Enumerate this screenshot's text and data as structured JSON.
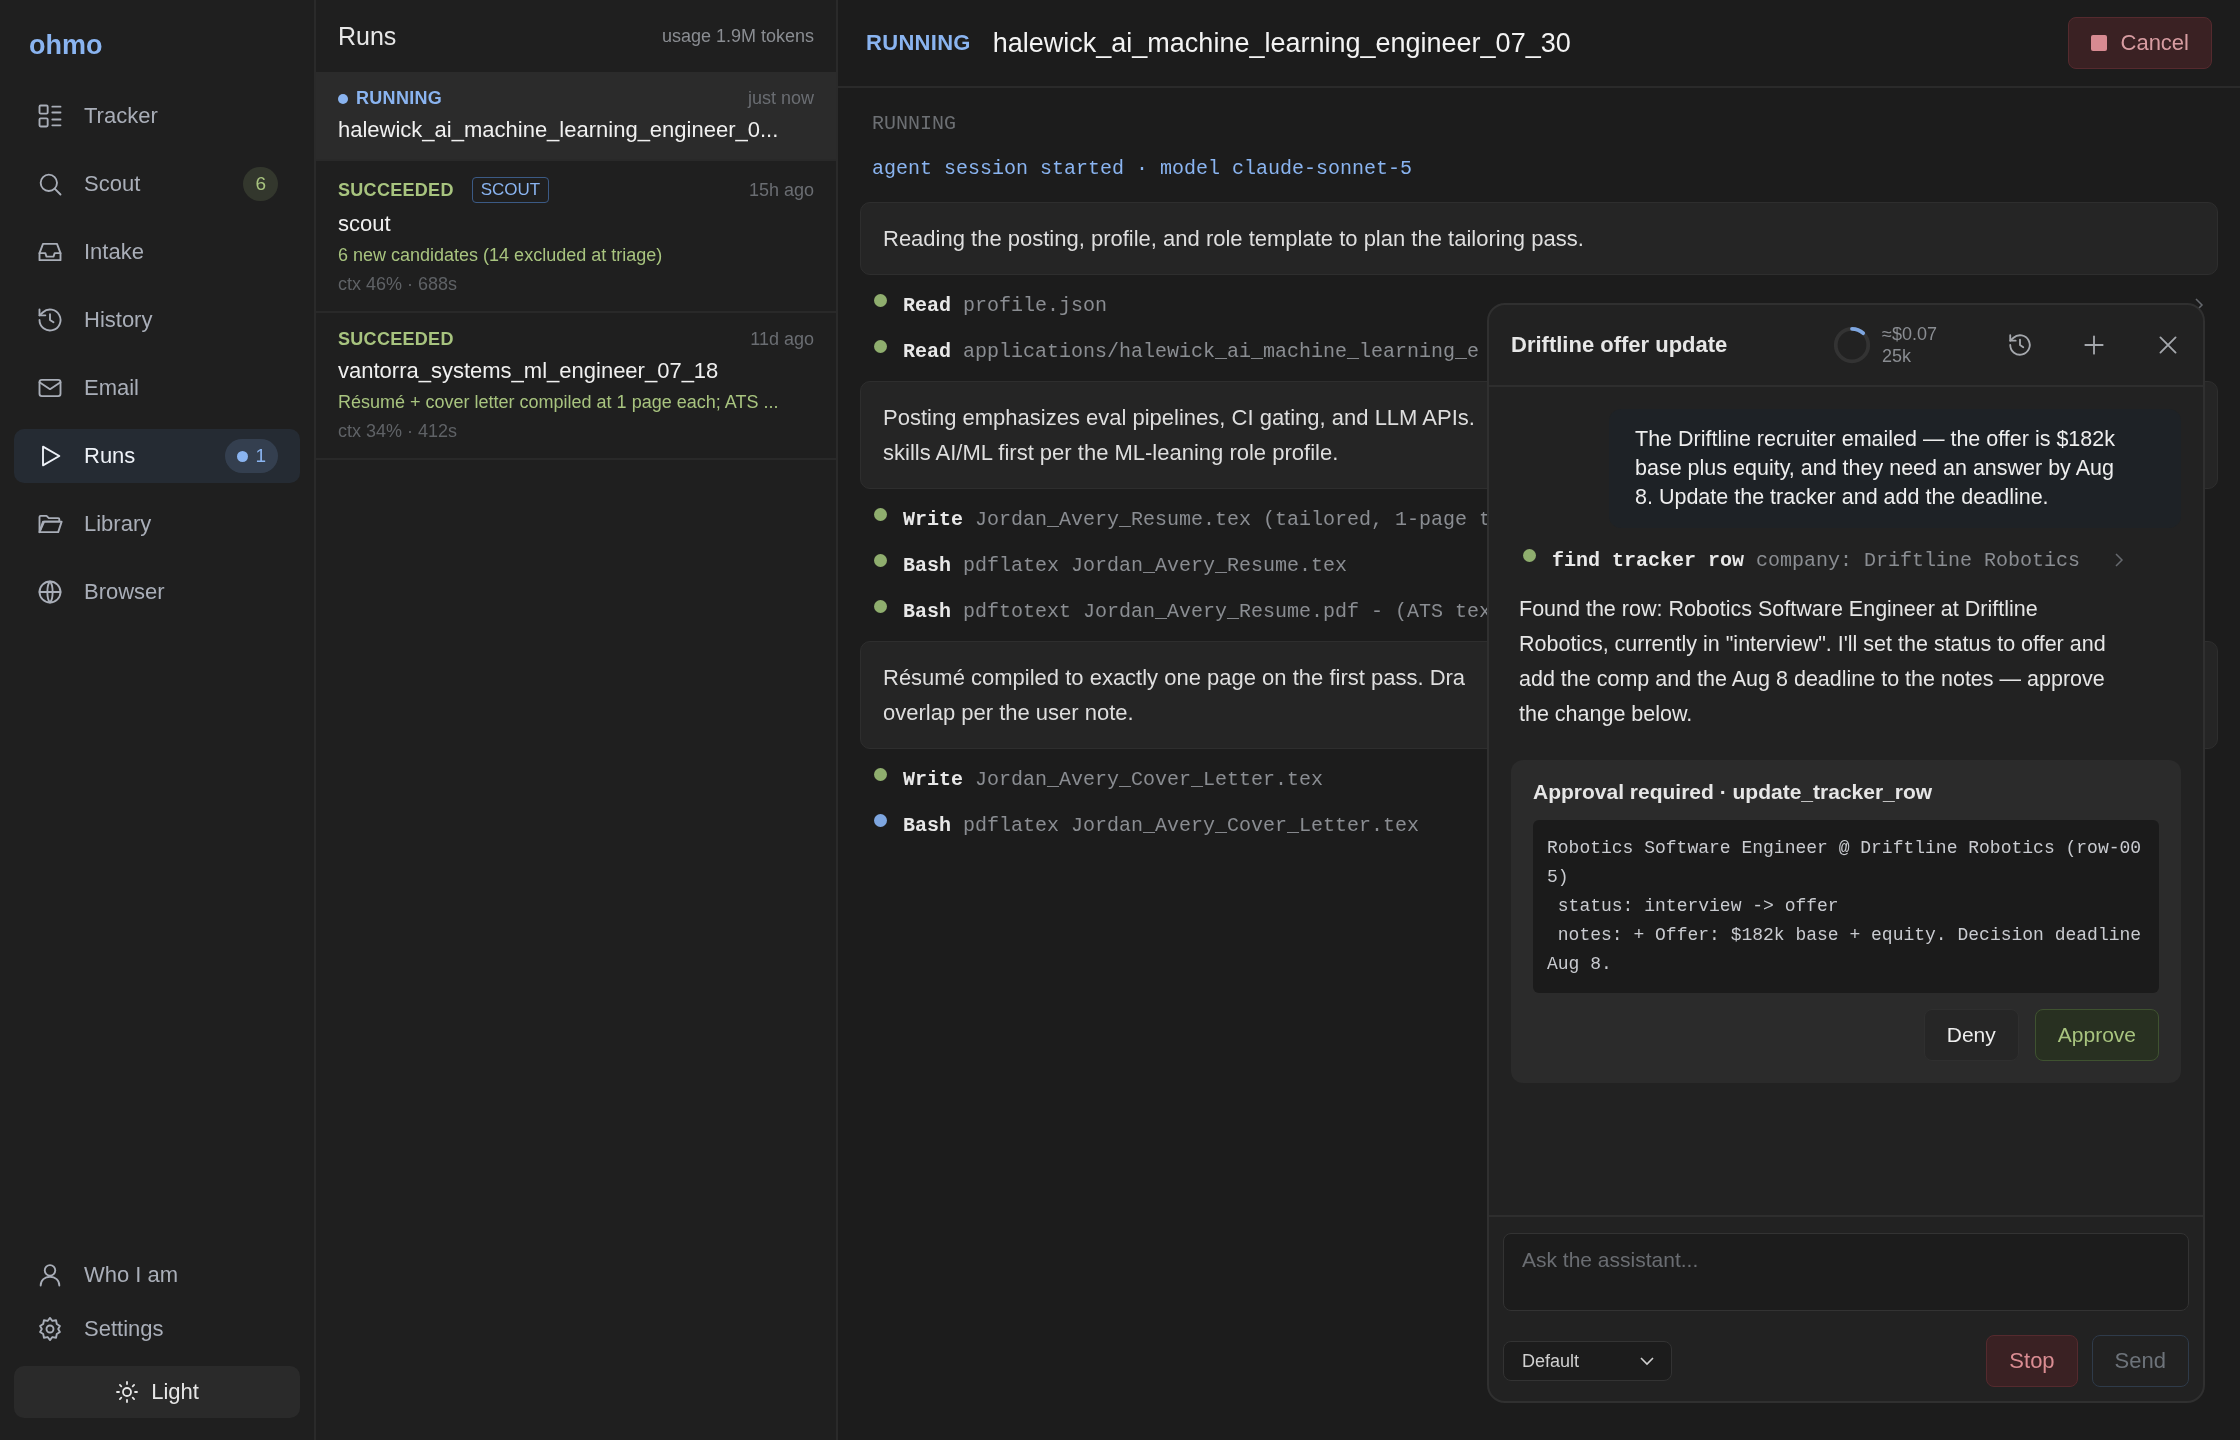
{
  "sidebar": {
    "logo": "ohmo",
    "items": [
      {
        "label": "Tracker",
        "selected": false
      },
      {
        "label": "Scout",
        "selected": false,
        "badge": {
          "text": "6",
          "dot": false,
          "color": "#a8c47f"
        }
      },
      {
        "label": "Intake",
        "selected": false
      },
      {
        "label": "History",
        "selected": false
      },
      {
        "label": "Email",
        "selected": false
      },
      {
        "label": "Runs",
        "selected": true,
        "badge": {
          "text": "1",
          "dot": true,
          "color": "#8ab4f0"
        }
      },
      {
        "label": "Library",
        "selected": false
      },
      {
        "label": "Browser",
        "selected": false
      }
    ],
    "bottom_items": [
      {
        "label": "Who I am"
      },
      {
        "label": "Settings"
      }
    ],
    "theme_button": "Light"
  },
  "runs": {
    "title": "Runs",
    "usage": "usage 1.9M tokens",
    "items": [
      {
        "status": "RUNNING",
        "color": "#8ab4f0",
        "dot": true,
        "time": "just now",
        "name": "halewick_ai_machine_learning_engineer_0...",
        "selected": true
      },
      {
        "status": "SUCCEEDED",
        "color": "#a8c47f",
        "dot": false,
        "tag": "SCOUT",
        "time": "15h ago",
        "name": "scout",
        "summary": "6 new candidates (14 excluded at triage)",
        "meta": "ctx 46% · 688s",
        "selected": false
      },
      {
        "status": "SUCCEEDED",
        "color": "#a8c47f",
        "dot": false,
        "time": "11d ago",
        "name": "vantorra_systems_ml_engineer_07_18",
        "summary": "Résumé + cover letter compiled at 1 page each; ATS ...",
        "meta": "ctx 34% · 412s",
        "selected": false
      }
    ]
  },
  "header": {
    "status": "RUNNING",
    "title": "halewick_ai_machine_learning_engineer_07_30",
    "cancel_button": "Cancel"
  },
  "log": [
    {
      "kind": "status",
      "text": "RUNNING"
    },
    {
      "kind": "event",
      "text": "agent session started · model claude-sonnet-5"
    },
    {
      "kind": "message",
      "lines": [
        "Reading the posting, profile, and role template to plan the tailoring pass."
      ]
    },
    {
      "kind": "tool",
      "tool": "Read",
      "arg": "profile.json",
      "color": "#8fae6e",
      "chevron": true
    },
    {
      "kind": "tool",
      "tool": "Read",
      "arg": "applications/halewick_ai_machine_learning_e",
      "color": "#8fae6e",
      "chevron": false
    },
    {
      "kind": "message",
      "lines": [
        "Posting emphasizes eval pipelines, CI gating, and LLM APIs.",
        "skills AI/ML first per the ML-leaning role profile."
      ]
    },
    {
      "kind": "tool",
      "tool": "Write",
      "arg": "Jordan_Avery_Resume.tex (tailored, 1-page t",
      "color": "#8fae6e",
      "chevron": false
    },
    {
      "kind": "tool",
      "tool": "Bash",
      "arg": "pdflatex Jordan_Avery_Resume.tex",
      "color": "#8fae6e",
      "chevron": false
    },
    {
      "kind": "tool",
      "tool": "Bash",
      "arg": "pdftotext Jordan_Avery_Resume.pdf - (ATS tex",
      "color": "#8fae6e",
      "chevron": false
    },
    {
      "kind": "message",
      "lines": [
        "Résumé compiled to exactly one page on the first pass. Dra",
        "overlap per the user note."
      ]
    },
    {
      "kind": "tool",
      "tool": "Write",
      "arg": "Jordan_Avery_Cover_Letter.tex",
      "color": "#8fae6e",
      "chevron": false
    },
    {
      "kind": "tool",
      "tool": "Bash",
      "arg": "pdflatex Jordan_Avery_Cover_Letter.tex",
      "color": "#7ea6e0",
      "chevron": false
    }
  ],
  "chat": {
    "title": "Driftline offer update",
    "context_meter": {
      "level": 0.12
    },
    "cost": "≈$0.07",
    "tokens": "25k",
    "messages": [
      {
        "kind": "user",
        "text": "The Driftline recruiter emailed — the offer is $182k base plus equity, and they need an answer by Aug 8. Update the tracker and add the deadline."
      },
      {
        "kind": "tool",
        "tool": "find tracker row",
        "arg": "company: Driftline Robotics",
        "color": "#8fae6e"
      },
      {
        "kind": "assistant",
        "text": "Found the row: Robotics Software Engineer at Driftline Robotics, currently in \"interview\". I'll set the status to offer and add the comp and the Aug 8 deadline to the notes — approve the change below."
      },
      {
        "kind": "approval",
        "title": "Approval required · update_tracker_row",
        "code": "Robotics Software Engineer @ Driftline Robotics (row-005)\n status: interview -> offer\n notes: + Offer: $182k base + equity. Decision deadline Aug 8.",
        "deny_button": "Deny",
        "approve_button": "Approve"
      }
    ],
    "input": {
      "placeholder": "Ask the assistant..."
    },
    "mode_select": "Default",
    "stop_button": "Stop",
    "send_button": {
      "label": "Send",
      "disabled": true
    }
  }
}
